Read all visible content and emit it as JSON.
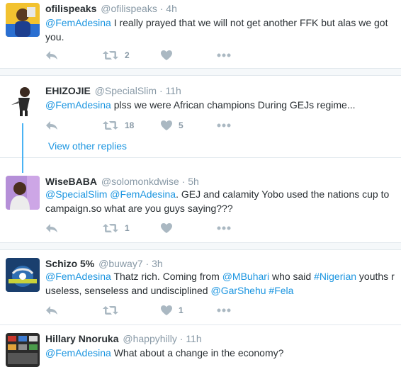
{
  "tweets": [
    {
      "name": "ofilispeaks",
      "handle": "@ofilispeaks",
      "sep": "·",
      "time": "4h",
      "line1": [
        {
          "t": "@FemAdesina",
          "link": true
        },
        {
          "t": " I really prayed that we will not get another FFK but alas we got",
          "link": false
        }
      ],
      "line2": [
        {
          "t": "you.",
          "link": false
        }
      ],
      "retweets": "2",
      "likes": ""
    },
    {
      "name": "EHIZOJIE",
      "handle": "@SpecialSlim",
      "sep": "·",
      "time": "11h",
      "line1": [
        {
          "t": "@FemAdesina",
          "link": true
        },
        {
          "t": " plss we were African champions During GEJs regime...",
          "link": false
        }
      ],
      "line2": [],
      "retweets": "18",
      "likes": "5"
    },
    {
      "name": "WiseBABA",
      "handle": "@solomonkdwise",
      "sep": "·",
      "time": "5h",
      "line1": [
        {
          "t": "@SpecialSlim",
          "link": true
        },
        {
          "t": " ",
          "link": false
        },
        {
          "t": "@FemAdesina",
          "link": true
        },
        {
          "t": ".  GEJ and calamity Yobo used the nations cup to",
          "link": false
        }
      ],
      "line2": [
        {
          "t": "campaign.so what are you guys saying???",
          "link": false
        }
      ],
      "retweets": "1",
      "likes": ""
    },
    {
      "name": "Schizo 5%",
      "handle": "@buway7",
      "sep": "·",
      "time": "3h",
      "line1": [
        {
          "t": "@FemAdesina",
          "link": true
        },
        {
          "t": " Thatz rich. Coming from ",
          "link": false
        },
        {
          "t": "@MBuhari",
          "link": true
        },
        {
          "t": " who said ",
          "link": false
        },
        {
          "t": "#Nigerian",
          "link": true
        },
        {
          "t": " youths r",
          "link": false
        }
      ],
      "line2": [
        {
          "t": "useless, senseless and undisciplined ",
          "link": false
        },
        {
          "t": "@GarShehu",
          "link": true
        },
        {
          "t": " ",
          "link": false
        },
        {
          "t": "#Fela",
          "link": true
        }
      ],
      "retweets": "",
      "likes": "1"
    },
    {
      "name": "Hillary Nnoruka",
      "handle": "@happyhilly",
      "sep": "·",
      "time": "11h",
      "line1": [
        {
          "t": "@FemAdesina",
          "link": true
        },
        {
          "t": " What about a change in the economy?",
          "link": false
        }
      ],
      "line2": [],
      "retweets": "",
      "likes": ""
    }
  ],
  "view_other_replies": "View other replies",
  "colors": {
    "link": "#1b95e0",
    "muted": "#8899a6",
    "icon": "#aab8c2",
    "thread_line": "#4ab3f4"
  }
}
